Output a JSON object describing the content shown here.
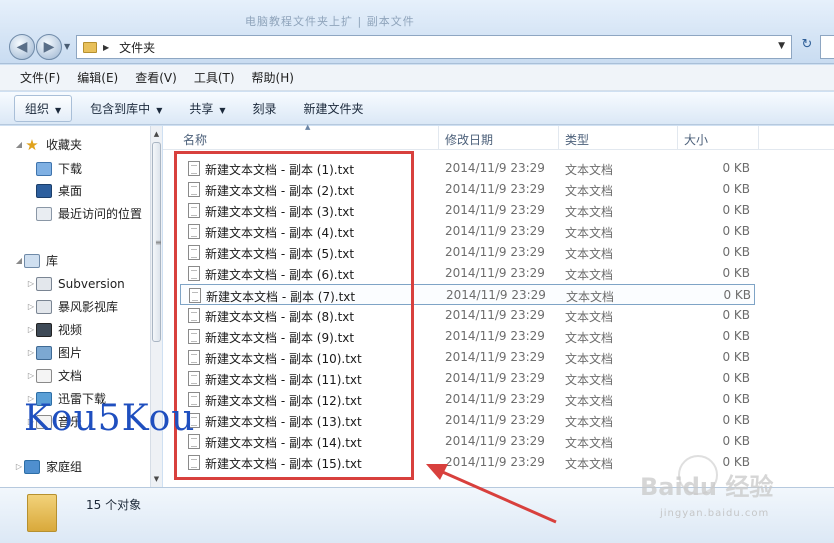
{
  "window": {
    "title_ghost": "电脑教程文件夹上扩 | 副本文件"
  },
  "address": {
    "path": "文件夹"
  },
  "menu": [
    "文件(F)",
    "编辑(E)",
    "查看(V)",
    "工具(T)",
    "帮助(H)"
  ],
  "toolbar": {
    "organize": "组织",
    "include_library": "包含到库中",
    "share": "共享",
    "burn": "刻录",
    "new_folder": "新建文件夹"
  },
  "nav": {
    "favorites": "收藏夹",
    "downloads": "下载",
    "desktop": "桌面",
    "recent": "最近访问的位置",
    "libraries": "库",
    "subversion": "Subversion",
    "storm": "暴风影视库",
    "videos": "视频",
    "pictures": "图片",
    "documents": "文档",
    "xunlei": "迅雷下载",
    "music": "音乐",
    "homegroup": "家庭组"
  },
  "columns": {
    "name": "名称",
    "date": "修改日期",
    "type": "类型",
    "size": "大小"
  },
  "files": [
    {
      "name": "新建文本文档 - 副本 (1).txt",
      "date": "2014/11/9 23:29",
      "type": "文本文档",
      "size": "0 KB"
    },
    {
      "name": "新建文本文档 - 副本 (2).txt",
      "date": "2014/11/9 23:29",
      "type": "文本文档",
      "size": "0 KB"
    },
    {
      "name": "新建文本文档 - 副本 (3).txt",
      "date": "2014/11/9 23:29",
      "type": "文本文档",
      "size": "0 KB"
    },
    {
      "name": "新建文本文档 - 副本 (4).txt",
      "date": "2014/11/9 23:29",
      "type": "文本文档",
      "size": "0 KB"
    },
    {
      "name": "新建文本文档 - 副本 (5).txt",
      "date": "2014/11/9 23:29",
      "type": "文本文档",
      "size": "0 KB"
    },
    {
      "name": "新建文本文档 - 副本 (6).txt",
      "date": "2014/11/9 23:29",
      "type": "文本文档",
      "size": "0 KB"
    },
    {
      "name": "新建文本文档 - 副本 (7).txt",
      "date": "2014/11/9 23:29",
      "type": "文本文档",
      "size": "0 KB"
    },
    {
      "name": "新建文本文档 - 副本 (8).txt",
      "date": "2014/11/9 23:29",
      "type": "文本文档",
      "size": "0 KB"
    },
    {
      "name": "新建文本文档 - 副本 (9).txt",
      "date": "2014/11/9 23:29",
      "type": "文本文档",
      "size": "0 KB"
    },
    {
      "name": "新建文本文档 - 副本 (10).txt",
      "date": "2014/11/9 23:29",
      "type": "文本文档",
      "size": "0 KB"
    },
    {
      "name": "新建文本文档 - 副本 (11).txt",
      "date": "2014/11/9 23:29",
      "type": "文本文档",
      "size": "0 KB"
    },
    {
      "name": "新建文本文档 - 副本 (12).txt",
      "date": "2014/11/9 23:29",
      "type": "文本文档",
      "size": "0 KB"
    },
    {
      "name": "新建文本文档 - 副本 (13).txt",
      "date": "2014/11/9 23:29",
      "type": "文本文档",
      "size": "0 KB"
    },
    {
      "name": "新建文本文档 - 副本 (14).txt",
      "date": "2014/11/9 23:29",
      "type": "文本文档",
      "size": "0 KB"
    },
    {
      "name": "新建文本文档 - 副本 (15).txt",
      "date": "2014/11/9 23:29",
      "type": "文本文档",
      "size": "0 KB"
    }
  ],
  "selected_index": 6,
  "status": {
    "count_text": "15 个对象"
  },
  "overlay": {
    "kou": "Kou5Kou",
    "baidu": "Baidu 经验",
    "baidu_sub": "jingyan.baidu.com"
  },
  "colors": {
    "highlight": "#d8403d",
    "accent": "#2f5f98"
  }
}
